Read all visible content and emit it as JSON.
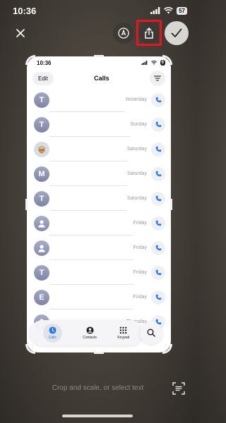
{
  "status_bar": {
    "time": "10:36",
    "battery": "57"
  },
  "toolbar": {
    "close": "close",
    "markup": "markup",
    "share": "share",
    "done": "done"
  },
  "screenshot": {
    "status_bar": {
      "time": "10:36",
      "battery": "6"
    },
    "header": {
      "edit_label": "Edit",
      "title": "Calls"
    },
    "calls": [
      {
        "initial": "T",
        "avatar": "letter",
        "date": "Yesterday"
      },
      {
        "initial": "T",
        "avatar": "letter",
        "date": "Sunday"
      },
      {
        "initial": "",
        "avatar": "memoji",
        "date": "Saturday"
      },
      {
        "initial": "M",
        "avatar": "letter",
        "date": "Saturday"
      },
      {
        "initial": "T",
        "avatar": "letter",
        "date": "Saturday"
      },
      {
        "initial": "",
        "avatar": "person",
        "date": "Friday"
      },
      {
        "initial": "",
        "avatar": "person",
        "date": "Friday"
      },
      {
        "initial": "T",
        "avatar": "letter",
        "date": "Friday"
      },
      {
        "initial": "E",
        "avatar": "letter",
        "date": "Friday"
      },
      {
        "initial": "",
        "avatar": "person",
        "date": "Thursday"
      }
    ],
    "tabs": [
      {
        "label": "Calls",
        "icon": "clock-icon",
        "active": true
      },
      {
        "label": "Contacts",
        "icon": "contact-icon",
        "active": false
      },
      {
        "label": "Keypad",
        "icon": "keypad-icon",
        "active": false
      }
    ]
  },
  "bottom_hint": "Crop and scale, or select text",
  "colors": {
    "accent": "#2b7bea",
    "highlight": "#e8141f"
  }
}
